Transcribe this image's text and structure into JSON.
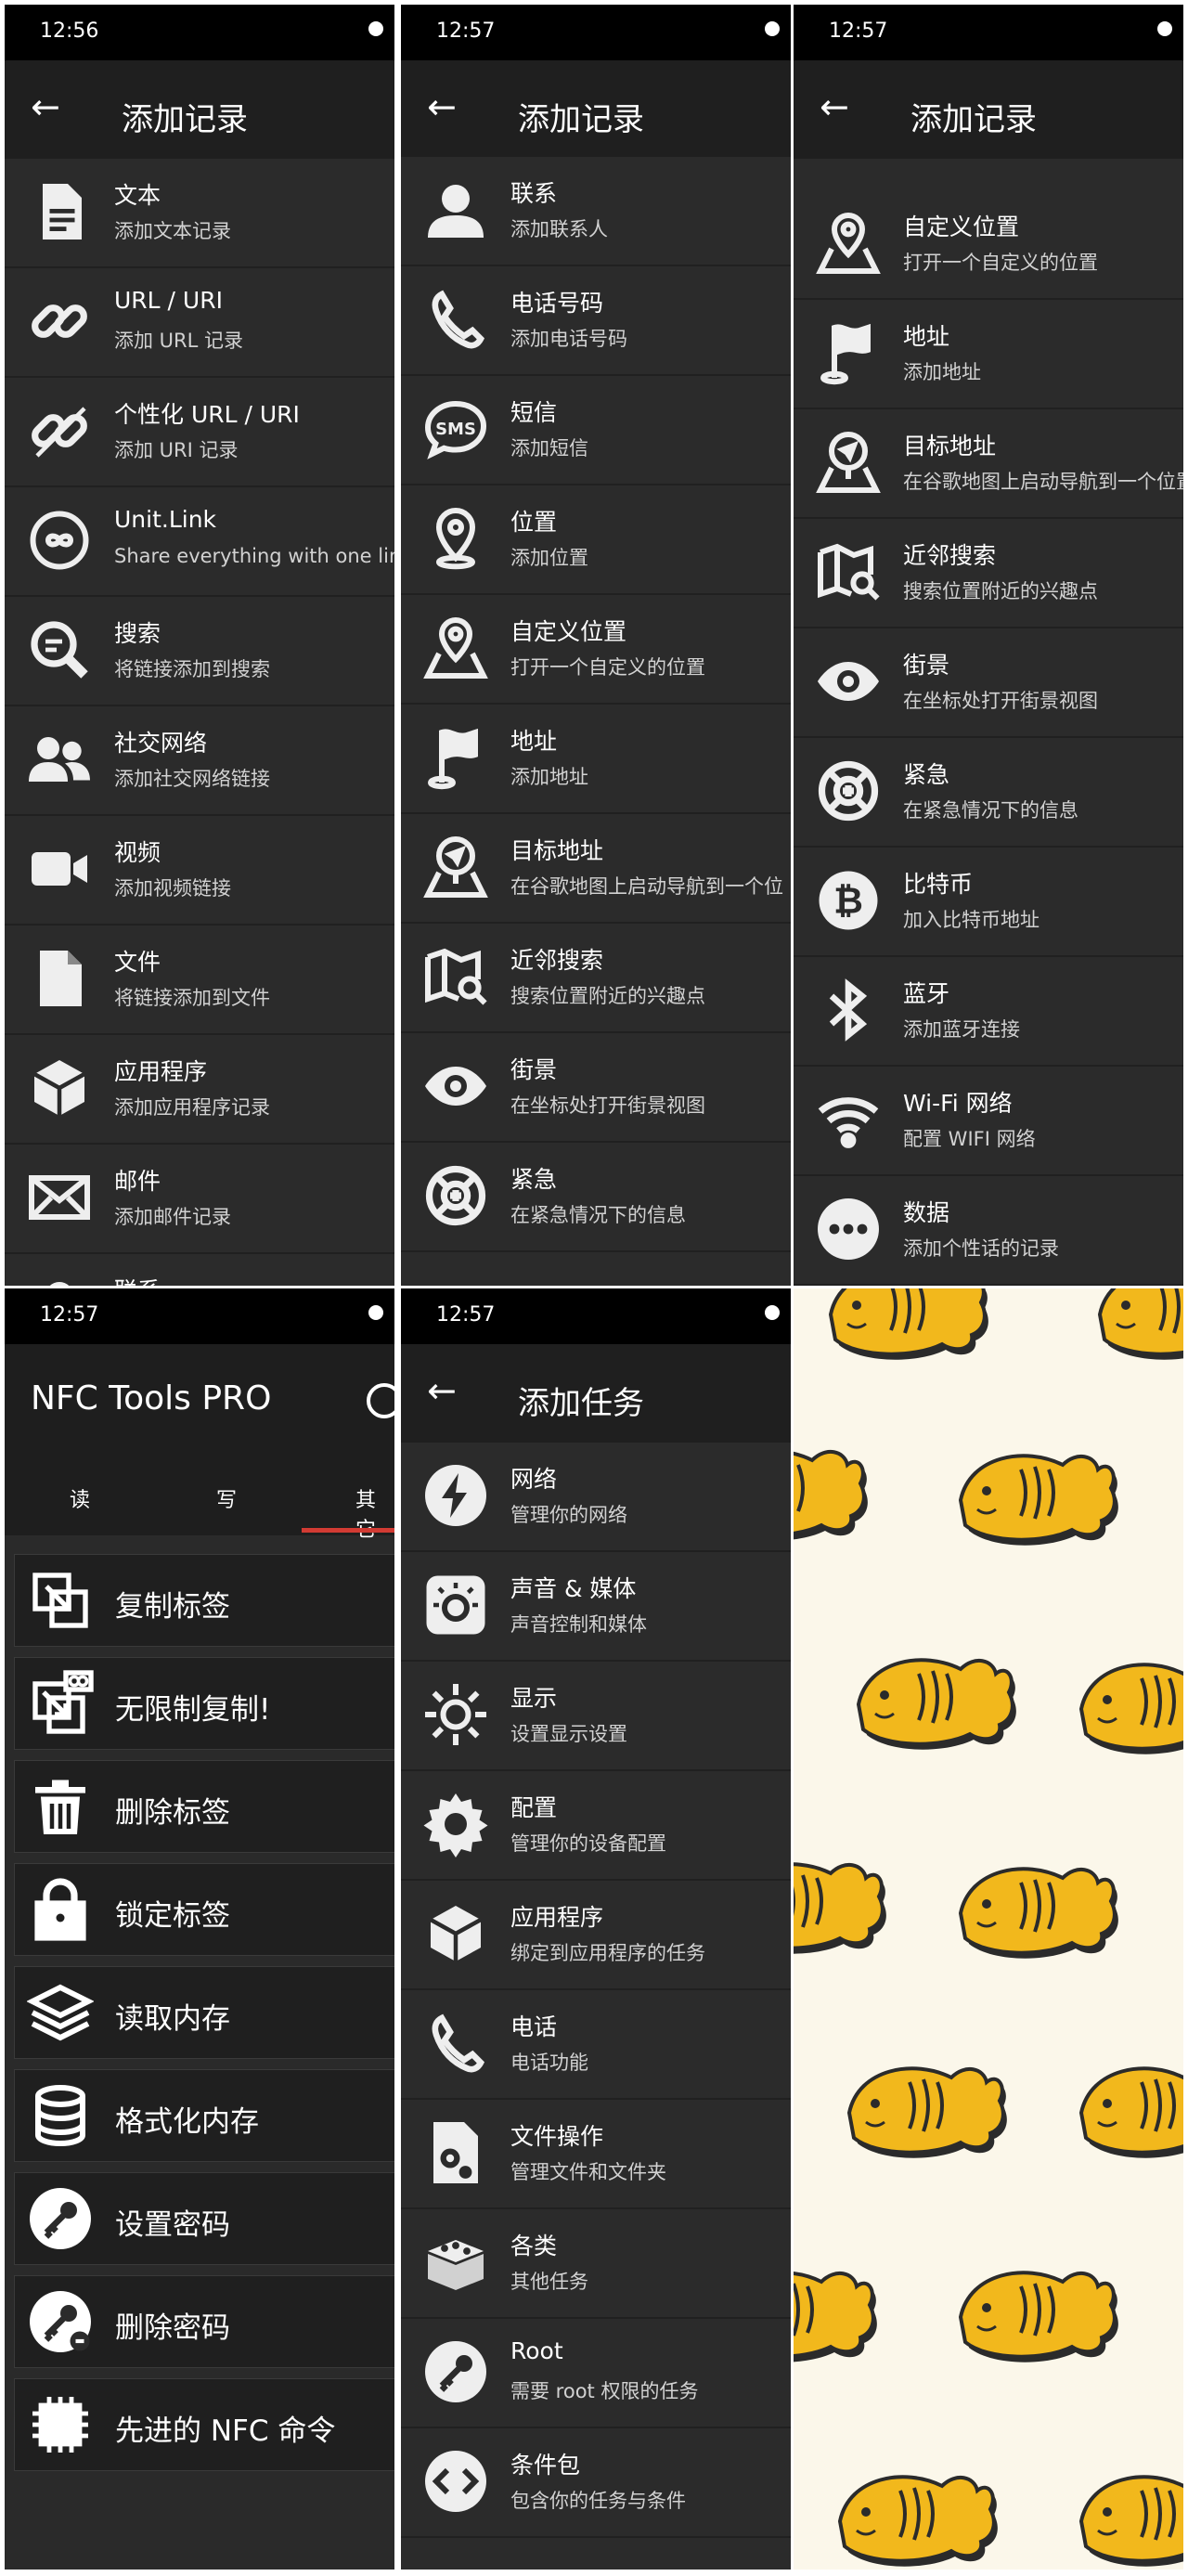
{
  "panel1": {
    "time": "12:56",
    "title": "添加记录",
    "items": [
      {
        "title": "文本",
        "subtitle": "添加文本记录",
        "icon": "document-icon"
      },
      {
        "title": "URL / URI",
        "subtitle": "添加 URL 记录",
        "icon": "link-icon"
      },
      {
        "title": "个性化 URL / URI",
        "subtitle": "添加 URI 记录",
        "icon": "custom-link-icon"
      },
      {
        "title": "Unit.Link",
        "subtitle": "Share everything with one link",
        "icon": "unitlink-icon"
      },
      {
        "title": "搜索",
        "subtitle": "将链接添加到搜索",
        "icon": "search-icon"
      },
      {
        "title": "社交网络",
        "subtitle": "添加社交网络链接",
        "icon": "people-icon"
      },
      {
        "title": "视频",
        "subtitle": "添加视频链接",
        "icon": "video-icon"
      },
      {
        "title": "文件",
        "subtitle": "将链接添加到文件",
        "icon": "file-icon"
      },
      {
        "title": "应用程序",
        "subtitle": "添加应用程序记录",
        "icon": "app-box-icon"
      },
      {
        "title": "邮件",
        "subtitle": "添加邮件记录",
        "icon": "mail-icon"
      },
      {
        "title": "联系",
        "subtitle": "",
        "icon": "contact-icon"
      }
    ]
  },
  "panel2": {
    "time": "12:57",
    "title": "添加记录",
    "items": [
      {
        "title": "联系",
        "subtitle": "添加联系人",
        "icon": "contact-icon"
      },
      {
        "title": "电话号码",
        "subtitle": "添加电话号码",
        "icon": "phone-icon"
      },
      {
        "title": "短信",
        "subtitle": "添加短信",
        "icon": "sms-icon"
      },
      {
        "title": "位置",
        "subtitle": "添加位置",
        "icon": "location-pin-icon"
      },
      {
        "title": "自定义位置",
        "subtitle": "打开一个自定义的位置",
        "icon": "custom-location-icon"
      },
      {
        "title": "地址",
        "subtitle": "添加地址",
        "icon": "flag-icon"
      },
      {
        "title": "目标地址",
        "subtitle": "在谷歌地图上启动导航到一个位",
        "icon": "navigation-icon"
      },
      {
        "title": "近邻搜索",
        "subtitle": "搜索位置附近的兴趣点",
        "icon": "map-search-icon"
      },
      {
        "title": "街景",
        "subtitle": "在坐标处打开街景视图",
        "icon": "eye-icon"
      },
      {
        "title": "紧急",
        "subtitle": "在紧急情况下的信息",
        "icon": "lifebuoy-icon"
      }
    ]
  },
  "panel3": {
    "time": "12:57",
    "title": "添加记录",
    "items": [
      {
        "title": "自定义位置",
        "subtitle": "打开一个自定义的位置",
        "icon": "custom-location-icon"
      },
      {
        "title": "地址",
        "subtitle": "添加地址",
        "icon": "flag-icon"
      },
      {
        "title": "目标地址",
        "subtitle": "在谷歌地图上启动导航到一个位置",
        "icon": "navigation-icon"
      },
      {
        "title": "近邻搜索",
        "subtitle": "搜索位置附近的兴趣点",
        "icon": "map-search-icon"
      },
      {
        "title": "街景",
        "subtitle": "在坐标处打开街景视图",
        "icon": "eye-icon"
      },
      {
        "title": "紧急",
        "subtitle": "在紧急情况下的信息",
        "icon": "lifebuoy-icon"
      },
      {
        "title": "比特币",
        "subtitle": "加入比特币地址",
        "icon": "bitcoin-icon"
      },
      {
        "title": "蓝牙",
        "subtitle": "添加蓝牙连接",
        "icon": "bluetooth-icon"
      },
      {
        "title": "Wi-Fi 网络",
        "subtitle": "配置 WIFI 网络",
        "icon": "wifi-icon"
      },
      {
        "title": "数据",
        "subtitle": "添加个性话的记录",
        "icon": "more-dots-icon"
      }
    ]
  },
  "panel4": {
    "time": "12:57",
    "app_title": "NFC Tools PRO",
    "tabs": [
      "读",
      "写",
      "其它"
    ],
    "items": [
      {
        "label": "复制标签",
        "icon": "copy-tag-icon"
      },
      {
        "label": "无限制复制!",
        "icon": "unlimited-copy-icon"
      },
      {
        "label": "删除标签",
        "icon": "trash-icon"
      },
      {
        "label": "锁定标签",
        "icon": "lock-icon"
      },
      {
        "label": "读取内存",
        "icon": "layers-icon"
      },
      {
        "label": "格式化内存",
        "icon": "database-icon"
      },
      {
        "label": "设置密码",
        "icon": "key-icon"
      },
      {
        "label": "删除密码",
        "icon": "key-remove-icon"
      },
      {
        "label": "先进的 NFC 命令",
        "icon": "chip-icon"
      }
    ]
  },
  "panel5": {
    "time": "12:57",
    "title": "添加任务",
    "items": [
      {
        "title": "网络",
        "subtitle": "管理你的网络",
        "icon": "lightning-icon"
      },
      {
        "title": "声音 & 媒体",
        "subtitle": "声音控制和媒体",
        "icon": "volume-knob-icon"
      },
      {
        "title": "显示",
        "subtitle": "设置显示设置",
        "icon": "sun-icon"
      },
      {
        "title": "配置",
        "subtitle": "管理你的设备配置",
        "icon": "gear-icon"
      },
      {
        "title": "应用程序",
        "subtitle": "绑定到应用程序的任务",
        "icon": "app-box-icon"
      },
      {
        "title": "电话",
        "subtitle": "电话功能",
        "icon": "phone-icon"
      },
      {
        "title": "文件操作",
        "subtitle": "管理文件和文件夹",
        "icon": "file-gear-icon"
      },
      {
        "title": "各类",
        "subtitle": "其他任务",
        "icon": "bricks-icon"
      },
      {
        "title": "Root",
        "subtitle": "需要 root 权限的任务",
        "icon": "key-icon"
      },
      {
        "title": "条件包",
        "subtitle": "包含你的任务与条件",
        "icon": "code-icon"
      }
    ]
  },
  "colors": {
    "panel_bg": "#2b2b2b",
    "appbar_bg": "#1f1f1f",
    "status_bar": "#000000",
    "tab_accent": "#d23b33",
    "pattern_bg": "#fbf7ea",
    "fish_fill": "#f2b81c"
  }
}
